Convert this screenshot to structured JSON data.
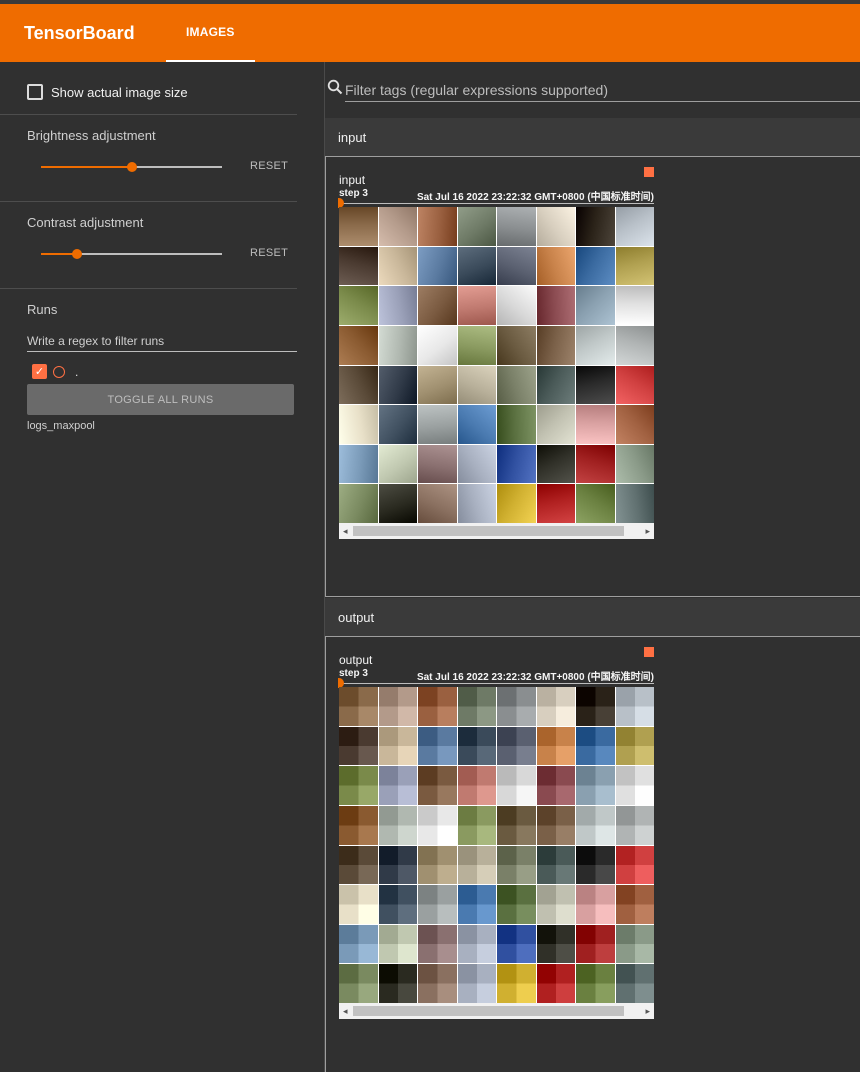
{
  "app": {
    "brand": "TensorBoard",
    "tab": "IMAGES"
  },
  "sidebar": {
    "show_actual_size": "Show actual image size",
    "brightness": {
      "title": "Brightness adjustment",
      "reset": "RESET",
      "value": 0.5
    },
    "contrast": {
      "title": "Contrast adjustment",
      "reset": "RESET",
      "value": 0.2
    },
    "runs": {
      "title": "Runs",
      "filter_placeholder": "Write a regex to filter runs",
      "items": [
        {
          "name": ".",
          "checked": true,
          "color": "#ff7043"
        }
      ],
      "toggle_all": "TOGGLE ALL RUNS",
      "run_label": "logs_maxpool"
    }
  },
  "main": {
    "filter_placeholder": "Filter tags (regular expressions supported)",
    "sections": [
      {
        "category": "input",
        "card": {
          "tag": "input",
          "step": "step 3",
          "time": "Sat Jul 16 2022 23:22:32 GMT+0800 (中国标准时间)",
          "pixelated": false
        }
      },
      {
        "category": "output",
        "card": {
          "tag": "output",
          "step": "step 3",
          "time": "Sat Jul 16 2022 23:22:32 GMT+0800 (中国标准时间)",
          "pixelated": true
        }
      }
    ]
  },
  "image_grid_colors": [
    "#8a6a4a",
    "#b39a8a",
    "#9a6040",
    "#6e7a66",
    "#8a8e90",
    "#d8cfbf",
    "#2a2218",
    "#b8c0c8",
    "#4a3a30",
    "#c9b79a",
    "#5a7aa0",
    "#3a4a5a",
    "#5a6070",
    "#c8824a",
    "#3a6aa0",
    "#b0a050",
    "#7a8a4a",
    "#9aa0b8",
    "#7a5a40",
    "#c07a70",
    "#d8d8d8",
    "#8a4a50",
    "#8aa0b0",
    "#e0e0e0",
    "#8a5a30",
    "#b0b8b0",
    "#e8e8e8",
    "#8a9a60",
    "#6a5a40",
    "#7a6048",
    "#c0c8c8",
    "#b0b4b4",
    "#5a4a38",
    "#303a48",
    "#a09070",
    "#b8b09a",
    "#7a8068",
    "#4a5a58",
    "#2a2a2a",
    "#d04040",
    "#e8e0c8",
    "#405060",
    "#9aa0a0",
    "#4a7ab0",
    "#5a7040",
    "#c0c0b0",
    "#d8a0a0",
    "#a06040",
    "#7a9ab8",
    "#c0c8b0",
    "#8a7070",
    "#a8b0c0",
    "#3050a0",
    "#303028",
    "#a02020",
    "#8a9a88",
    "#7a8a60",
    "#2a2a20",
    "#8a7060",
    "#a8b0c0",
    "#d0b030",
    "#b02020",
    "#6a8040",
    "#607070"
  ]
}
